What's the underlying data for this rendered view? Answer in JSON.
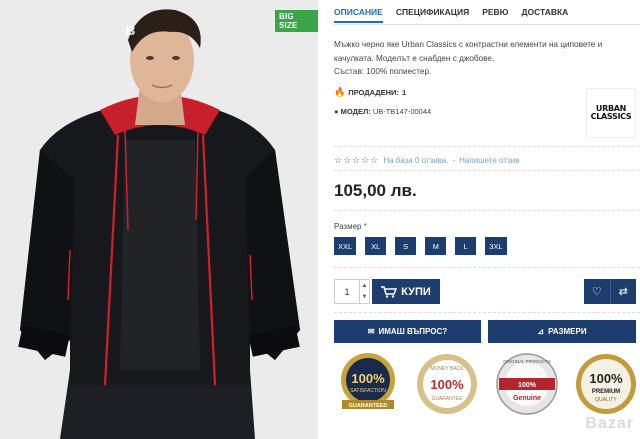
{
  "photo": {
    "badge": "BIG SIZE",
    "corner_text": "в"
  },
  "tabs": [
    {
      "label": "ОПИСАНИЕ",
      "active": true
    },
    {
      "label": "СПЕЦИФИКАЦИЯ",
      "active": false
    },
    {
      "label": "РЕВЮ",
      "active": false
    },
    {
      "label": "ДОСТАВКА",
      "active": false
    }
  ],
  "description": {
    "line1": "Мъжко черно яке Urban Classics с контрастни елементи на циповете и",
    "line2": "качулката. Моделът е снабден с джобове.",
    "line3": "Състав: 100% полиестер."
  },
  "sold": {
    "label": "ПРОДАДЕНИ:",
    "count": "1"
  },
  "model": {
    "label": "МОДЕЛ:",
    "value": "UB-TB147-00044"
  },
  "brand": {
    "line1": "URBAN",
    "line2": "CLASSICS"
  },
  "rating": {
    "stars": "☆☆☆☆☆",
    "text": "На база 0 отзива.",
    "sep": "-",
    "link": "Напишете отзив"
  },
  "price": "105,00 лв.",
  "size": {
    "label": "Размер",
    "required": "*",
    "options": [
      "XXL",
      "XL",
      "S",
      "M",
      "L",
      "3XL"
    ]
  },
  "cart": {
    "quantity": "1",
    "buy_label": "КУПИ"
  },
  "actions": {
    "ask_label": "ИМАШ ВЪПРОС?",
    "sizes_label": "РАЗМЕРИ"
  },
  "badges": [
    {
      "top": "100%",
      "sub": "SATISFACTION",
      "ribbon": "GUARANTEED",
      "color": "#c8a23c"
    },
    {
      "top": "100%",
      "sub": "MONEY BACK",
      "ribbon": "GUARANTEE",
      "color": "#d8c089"
    },
    {
      "top": "100%",
      "sub": "Genuine",
      "ribbon": "ORIGINAL PRODUCTS",
      "color": "#b3262d"
    },
    {
      "top": "100%",
      "sub": "PREMIUM",
      "ribbon": "QUALITY",
      "color": "#c59a3a"
    }
  ],
  "watermark": "Bazar",
  "colors": {
    "accent": "#1e6fb8",
    "button": "#1c3d6e",
    "badge_green": "#3aa64a",
    "flame": "#f07b1c"
  }
}
